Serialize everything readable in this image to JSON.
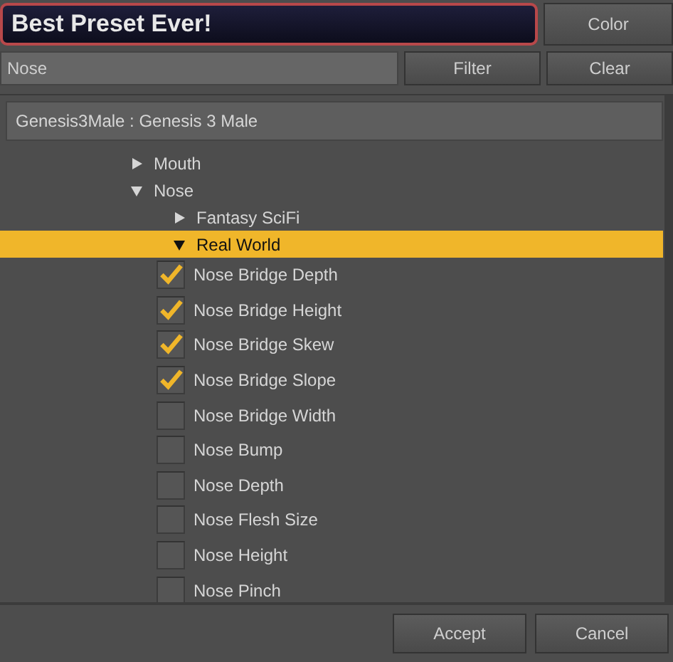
{
  "preset_name": {
    "value": "Best Preset Ever!"
  },
  "color_button": "Color",
  "filter_field": {
    "value": "Nose"
  },
  "filter_button": "Filter",
  "clear_button": "Clear",
  "figure_header": "Genesis3Male : Genesis 3 Male",
  "tree": [
    {
      "kind": "folder",
      "label": "Mouth",
      "expanded": false,
      "selected": false
    },
    {
      "kind": "folder",
      "label": "Nose",
      "expanded": true,
      "selected": false,
      "children": [
        {
          "kind": "folder",
          "label": "Fantasy SciFi",
          "expanded": false,
          "selected": false
        },
        {
          "kind": "folder",
          "label": "Real World",
          "expanded": true,
          "selected": true,
          "children": [
            {
              "kind": "check",
              "label": "Nose Bridge Depth",
              "checked": true
            },
            {
              "kind": "check",
              "label": "Nose Bridge Height",
              "checked": true
            },
            {
              "kind": "check",
              "label": "Nose Bridge Skew",
              "checked": true
            },
            {
              "kind": "check",
              "label": "Nose Bridge Slope",
              "checked": true
            },
            {
              "kind": "check",
              "label": "Nose Bridge Width",
              "checked": false
            },
            {
              "kind": "check",
              "label": "Nose Bump",
              "checked": false
            },
            {
              "kind": "check",
              "label": "Nose Depth",
              "checked": false
            },
            {
              "kind": "check",
              "label": "Nose Flesh Size",
              "checked": false
            },
            {
              "kind": "check",
              "label": "Nose Height",
              "checked": false
            },
            {
              "kind": "check",
              "label": "Nose Pinch",
              "checked": false
            }
          ]
        }
      ]
    }
  ],
  "buttons": [
    "Accept",
    "Cancel"
  ]
}
